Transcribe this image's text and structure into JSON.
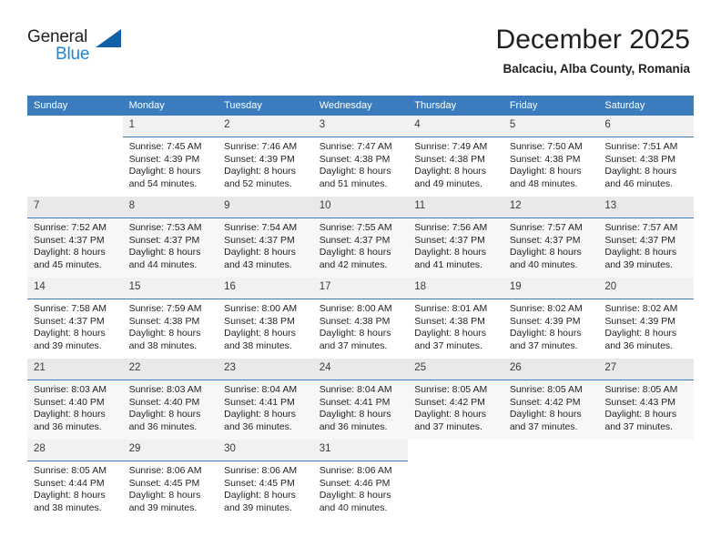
{
  "logo": {
    "word1": "General",
    "word2": "Blue",
    "triangle_color": "#1161a8",
    "blue_color": "#1b87d4"
  },
  "header": {
    "title": "December 2025",
    "subtitle": "Balcaciu, Alba County, Romania"
  },
  "theme": {
    "header_row_bg": "#3a7cbe",
    "daynum_bg": "#f1f1f1",
    "alt_row_bg": "#f7f7f7"
  },
  "weekdays": [
    "Sunday",
    "Monday",
    "Tuesday",
    "Wednesday",
    "Thursday",
    "Friday",
    "Saturday"
  ],
  "labels": {
    "sunrise_prefix": "Sunrise:",
    "sunset_prefix": "Sunset:",
    "daylight_prefix": "Daylight:"
  },
  "weeks": [
    [
      {
        "day": "",
        "sunrise": "",
        "sunset": "",
        "daylight1": "",
        "daylight2": ""
      },
      {
        "day": "1",
        "sunrise": "Sunrise: 7:45 AM",
        "sunset": "Sunset: 4:39 PM",
        "daylight1": "Daylight: 8 hours",
        "daylight2": "and 54 minutes."
      },
      {
        "day": "2",
        "sunrise": "Sunrise: 7:46 AM",
        "sunset": "Sunset: 4:39 PM",
        "daylight1": "Daylight: 8 hours",
        "daylight2": "and 52 minutes."
      },
      {
        "day": "3",
        "sunrise": "Sunrise: 7:47 AM",
        "sunset": "Sunset: 4:38 PM",
        "daylight1": "Daylight: 8 hours",
        "daylight2": "and 51 minutes."
      },
      {
        "day": "4",
        "sunrise": "Sunrise: 7:49 AM",
        "sunset": "Sunset: 4:38 PM",
        "daylight1": "Daylight: 8 hours",
        "daylight2": "and 49 minutes."
      },
      {
        "day": "5",
        "sunrise": "Sunrise: 7:50 AM",
        "sunset": "Sunset: 4:38 PM",
        "daylight1": "Daylight: 8 hours",
        "daylight2": "and 48 minutes."
      },
      {
        "day": "6",
        "sunrise": "Sunrise: 7:51 AM",
        "sunset": "Sunset: 4:38 PM",
        "daylight1": "Daylight: 8 hours",
        "daylight2": "and 46 minutes."
      }
    ],
    [
      {
        "day": "7",
        "sunrise": "Sunrise: 7:52 AM",
        "sunset": "Sunset: 4:37 PM",
        "daylight1": "Daylight: 8 hours",
        "daylight2": "and 45 minutes."
      },
      {
        "day": "8",
        "sunrise": "Sunrise: 7:53 AM",
        "sunset": "Sunset: 4:37 PM",
        "daylight1": "Daylight: 8 hours",
        "daylight2": "and 44 minutes."
      },
      {
        "day": "9",
        "sunrise": "Sunrise: 7:54 AM",
        "sunset": "Sunset: 4:37 PM",
        "daylight1": "Daylight: 8 hours",
        "daylight2": "and 43 minutes."
      },
      {
        "day": "10",
        "sunrise": "Sunrise: 7:55 AM",
        "sunset": "Sunset: 4:37 PM",
        "daylight1": "Daylight: 8 hours",
        "daylight2": "and 42 minutes."
      },
      {
        "day": "11",
        "sunrise": "Sunrise: 7:56 AM",
        "sunset": "Sunset: 4:37 PM",
        "daylight1": "Daylight: 8 hours",
        "daylight2": "and 41 minutes."
      },
      {
        "day": "12",
        "sunrise": "Sunrise: 7:57 AM",
        "sunset": "Sunset: 4:37 PM",
        "daylight1": "Daylight: 8 hours",
        "daylight2": "and 40 minutes."
      },
      {
        "day": "13",
        "sunrise": "Sunrise: 7:57 AM",
        "sunset": "Sunset: 4:37 PM",
        "daylight1": "Daylight: 8 hours",
        "daylight2": "and 39 minutes."
      }
    ],
    [
      {
        "day": "14",
        "sunrise": "Sunrise: 7:58 AM",
        "sunset": "Sunset: 4:37 PM",
        "daylight1": "Daylight: 8 hours",
        "daylight2": "and 39 minutes."
      },
      {
        "day": "15",
        "sunrise": "Sunrise: 7:59 AM",
        "sunset": "Sunset: 4:38 PM",
        "daylight1": "Daylight: 8 hours",
        "daylight2": "and 38 minutes."
      },
      {
        "day": "16",
        "sunrise": "Sunrise: 8:00 AM",
        "sunset": "Sunset: 4:38 PM",
        "daylight1": "Daylight: 8 hours",
        "daylight2": "and 38 minutes."
      },
      {
        "day": "17",
        "sunrise": "Sunrise: 8:00 AM",
        "sunset": "Sunset: 4:38 PM",
        "daylight1": "Daylight: 8 hours",
        "daylight2": "and 37 minutes."
      },
      {
        "day": "18",
        "sunrise": "Sunrise: 8:01 AM",
        "sunset": "Sunset: 4:38 PM",
        "daylight1": "Daylight: 8 hours",
        "daylight2": "and 37 minutes."
      },
      {
        "day": "19",
        "sunrise": "Sunrise: 8:02 AM",
        "sunset": "Sunset: 4:39 PM",
        "daylight1": "Daylight: 8 hours",
        "daylight2": "and 37 minutes."
      },
      {
        "day": "20",
        "sunrise": "Sunrise: 8:02 AM",
        "sunset": "Sunset: 4:39 PM",
        "daylight1": "Daylight: 8 hours",
        "daylight2": "and 36 minutes."
      }
    ],
    [
      {
        "day": "21",
        "sunrise": "Sunrise: 8:03 AM",
        "sunset": "Sunset: 4:40 PM",
        "daylight1": "Daylight: 8 hours",
        "daylight2": "and 36 minutes."
      },
      {
        "day": "22",
        "sunrise": "Sunrise: 8:03 AM",
        "sunset": "Sunset: 4:40 PM",
        "daylight1": "Daylight: 8 hours",
        "daylight2": "and 36 minutes."
      },
      {
        "day": "23",
        "sunrise": "Sunrise: 8:04 AM",
        "sunset": "Sunset: 4:41 PM",
        "daylight1": "Daylight: 8 hours",
        "daylight2": "and 36 minutes."
      },
      {
        "day": "24",
        "sunrise": "Sunrise: 8:04 AM",
        "sunset": "Sunset: 4:41 PM",
        "daylight1": "Daylight: 8 hours",
        "daylight2": "and 36 minutes."
      },
      {
        "day": "25",
        "sunrise": "Sunrise: 8:05 AM",
        "sunset": "Sunset: 4:42 PM",
        "daylight1": "Daylight: 8 hours",
        "daylight2": "and 37 minutes."
      },
      {
        "day": "26",
        "sunrise": "Sunrise: 8:05 AM",
        "sunset": "Sunset: 4:42 PM",
        "daylight1": "Daylight: 8 hours",
        "daylight2": "and 37 minutes."
      },
      {
        "day": "27",
        "sunrise": "Sunrise: 8:05 AM",
        "sunset": "Sunset: 4:43 PM",
        "daylight1": "Daylight: 8 hours",
        "daylight2": "and 37 minutes."
      }
    ],
    [
      {
        "day": "28",
        "sunrise": "Sunrise: 8:05 AM",
        "sunset": "Sunset: 4:44 PM",
        "daylight1": "Daylight: 8 hours",
        "daylight2": "and 38 minutes."
      },
      {
        "day": "29",
        "sunrise": "Sunrise: 8:06 AM",
        "sunset": "Sunset: 4:45 PM",
        "daylight1": "Daylight: 8 hours",
        "daylight2": "and 39 minutes."
      },
      {
        "day": "30",
        "sunrise": "Sunrise: 8:06 AM",
        "sunset": "Sunset: 4:45 PM",
        "daylight1": "Daylight: 8 hours",
        "daylight2": "and 39 minutes."
      },
      {
        "day": "31",
        "sunrise": "Sunrise: 8:06 AM",
        "sunset": "Sunset: 4:46 PM",
        "daylight1": "Daylight: 8 hours",
        "daylight2": "and 40 minutes."
      },
      {
        "day": "",
        "sunrise": "",
        "sunset": "",
        "daylight1": "",
        "daylight2": ""
      },
      {
        "day": "",
        "sunrise": "",
        "sunset": "",
        "daylight1": "",
        "daylight2": ""
      },
      {
        "day": "",
        "sunrise": "",
        "sunset": "",
        "daylight1": "",
        "daylight2": ""
      }
    ]
  ]
}
